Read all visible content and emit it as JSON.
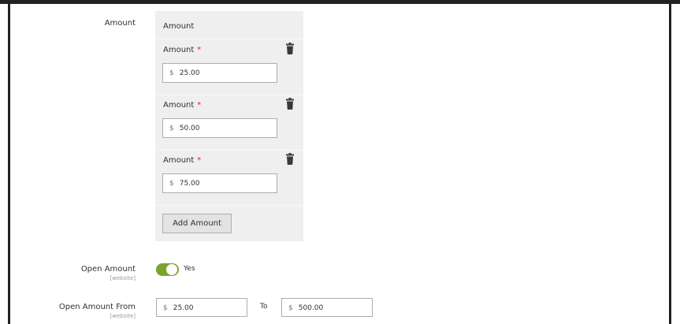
{
  "amount_section": {
    "field_label": "Amount",
    "panel_header": "Amount",
    "rows": [
      {
        "label": "Amount",
        "required_mark": "*",
        "currency": "$",
        "value": "25.00"
      },
      {
        "label": "Amount",
        "required_mark": "*",
        "currency": "$",
        "value": "50.00"
      },
      {
        "label": "Amount",
        "required_mark": "*",
        "currency": "$",
        "value": "75.00"
      }
    ],
    "add_button_label": "Add Amount"
  },
  "open_amount": {
    "label": "Open Amount",
    "scope": "[website]",
    "toggle_state": "Yes",
    "toggle_on": true,
    "accent_color": "#79a22e"
  },
  "open_amount_range": {
    "label": "Open Amount From",
    "scope": "[website]",
    "from_currency": "$",
    "from_value": "25.00",
    "to_label": "To",
    "to_currency": "$",
    "to_value": "500.00"
  },
  "icons": {
    "delete": "trash-icon"
  },
  "colors": {
    "required": "#e22626",
    "panel_bg": "#efefef"
  }
}
